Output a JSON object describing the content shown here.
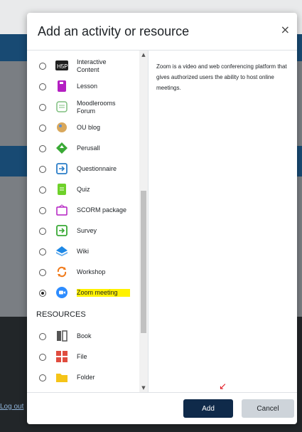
{
  "background": {
    "logout_link": "Log out"
  },
  "modal": {
    "title": "Add an activity or resource",
    "close_symbol": "×",
    "activities": [
      {
        "label": "Interactive Content",
        "icon": "h5p-icon",
        "color": "#1f1f1f",
        "selected": false
      },
      {
        "label": "Lesson",
        "icon": "lesson-icon",
        "color": "#b41fc2",
        "selected": false
      },
      {
        "label": "Moodlerooms Forum",
        "icon": "forum-icon",
        "color": "#7fbf7f",
        "selected": false
      },
      {
        "label": "OU blog",
        "icon": "blog-icon",
        "color": "#d9a85c",
        "selected": false
      },
      {
        "label": "Perusall",
        "icon": "perusall-icon",
        "color": "#39a935",
        "selected": false
      },
      {
        "label": "Questionnaire",
        "icon": "questionnaire-icon",
        "color": "#2b7ec8",
        "selected": false
      },
      {
        "label": "Quiz",
        "icon": "quiz-icon",
        "color": "#6ed12a",
        "selected": false
      },
      {
        "label": "SCORM package",
        "icon": "scorm-icon",
        "color": "#b41fc2",
        "selected": false
      },
      {
        "label": "Survey",
        "icon": "survey-icon",
        "color": "#39a935",
        "selected": false
      },
      {
        "label": "Wiki",
        "icon": "wiki-icon",
        "color": "#1e88e5",
        "selected": false
      },
      {
        "label": "Workshop",
        "icon": "workshop-icon",
        "color": "#f07a1a",
        "selected": false
      },
      {
        "label": "Zoom meeting",
        "icon": "zoom-icon",
        "color": "#2d8cff",
        "selected": true
      }
    ],
    "resources_heading": "RESOURCES",
    "resources": [
      {
        "label": "Book",
        "icon": "book-icon",
        "color": "#555555"
      },
      {
        "label": "File",
        "icon": "file-icon",
        "color": "#e04c3f"
      },
      {
        "label": "Folder",
        "icon": "folder-icon",
        "color": "#f5c418"
      }
    ],
    "description": "Zoom is a video and web conferencing platform that gives authorized users the ability to host online meetings.",
    "add_label": "Add",
    "cancel_label": "Cancel"
  }
}
